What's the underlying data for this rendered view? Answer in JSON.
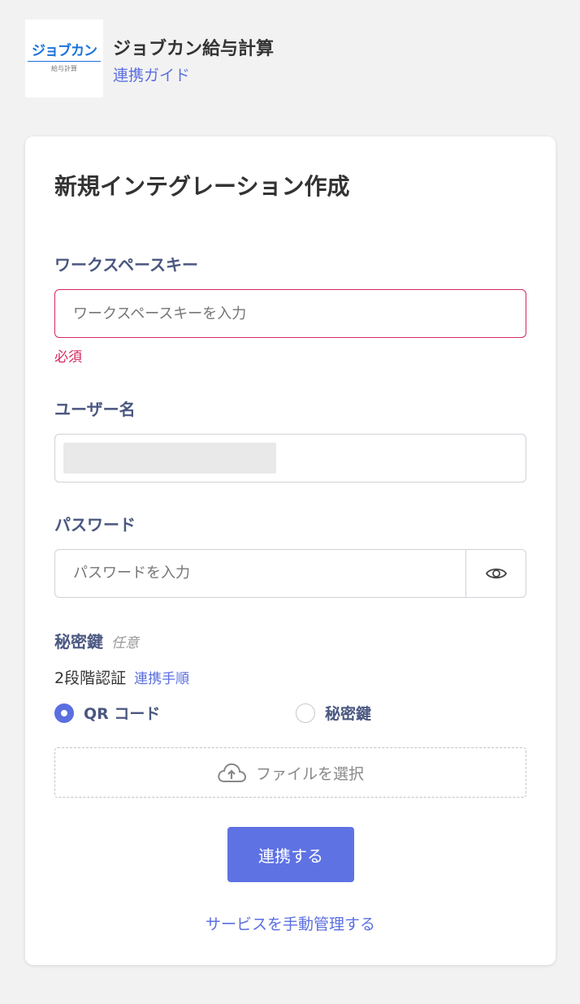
{
  "header": {
    "logo_main": "ジョブカン",
    "logo_sub": "給与計算",
    "app_title": "ジョブカン給与計算",
    "guide_link": "連携ガイド"
  },
  "form": {
    "title": "新規インテグレーション作成",
    "workspace_key": {
      "label": "ワークスペースキー",
      "placeholder": "ワークスペースキーを入力",
      "error": "必須"
    },
    "username": {
      "label": "ユーザー名"
    },
    "password": {
      "label": "パスワード",
      "placeholder": "パスワードを入力"
    },
    "secret_key": {
      "label": "秘密鍵",
      "optional": "任意"
    },
    "two_factor": {
      "label": "2段階認証",
      "steps_link": "連携手順",
      "options": [
        "QR コード",
        "秘密鍵"
      ],
      "selected": "QR コード"
    },
    "file_select": "ファイルを選択",
    "submit": "連携する",
    "manual_link": "サービスを手動管理する"
  },
  "colors": {
    "accent": "#5e72e4",
    "error": "#d4295f",
    "label": "#4a5780"
  }
}
